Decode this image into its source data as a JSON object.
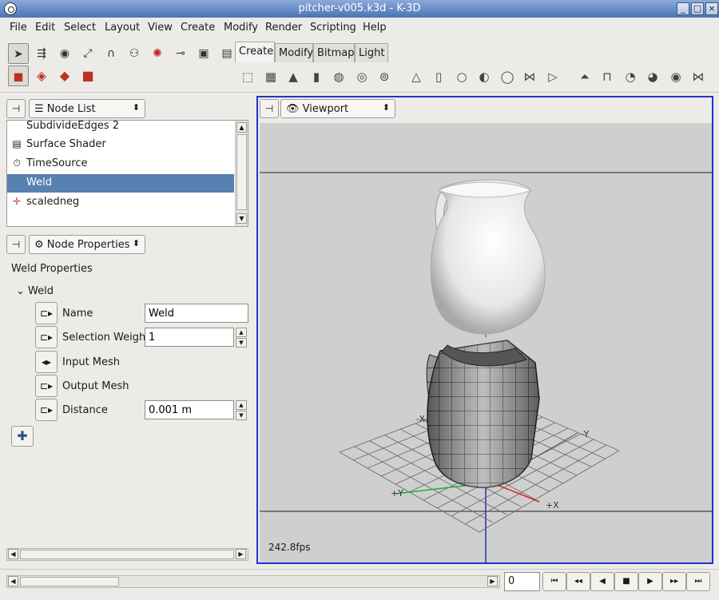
{
  "window": {
    "title": "pitcher-v005.k3d - K-3D"
  },
  "menu": [
    "File",
    "Edit",
    "Select",
    "Layout",
    "View",
    "Create",
    "Modify",
    "Render",
    "Scripting",
    "Help"
  ],
  "tabs": [
    "Create",
    "Modify",
    "Bitmap",
    "Light"
  ],
  "node_list_panel": {
    "combo": "Node List",
    "items": [
      {
        "label": "SubdivideEdges 2",
        "icon": ""
      },
      {
        "label": "Surface Shader",
        "icon": "shader-icon"
      },
      {
        "label": "TimeSource",
        "icon": "stopwatch-icon"
      },
      {
        "label": "Weld",
        "icon": "",
        "selected": true
      },
      {
        "label": "scaledneg",
        "icon": "transform-icon"
      }
    ]
  },
  "properties_panel": {
    "combo": "Node Properties",
    "title": "Weld Properties",
    "group": "Weld",
    "rows": [
      {
        "label": "Name",
        "value": "Weld"
      },
      {
        "label": "Selection Weight",
        "value": "1"
      },
      {
        "label": "Input Mesh"
      },
      {
        "label": "Output Mesh"
      },
      {
        "label": "Distance",
        "value": "0.001 m"
      }
    ]
  },
  "viewport_panel": {
    "combo": "Viewport",
    "fps": "242.8fps",
    "axis_labels": {
      "neg_y": "-Y",
      "pos_y": "+Y",
      "pos_x": "+X",
      "neg_x": "-X"
    }
  },
  "timeline": {
    "frame": "0"
  }
}
